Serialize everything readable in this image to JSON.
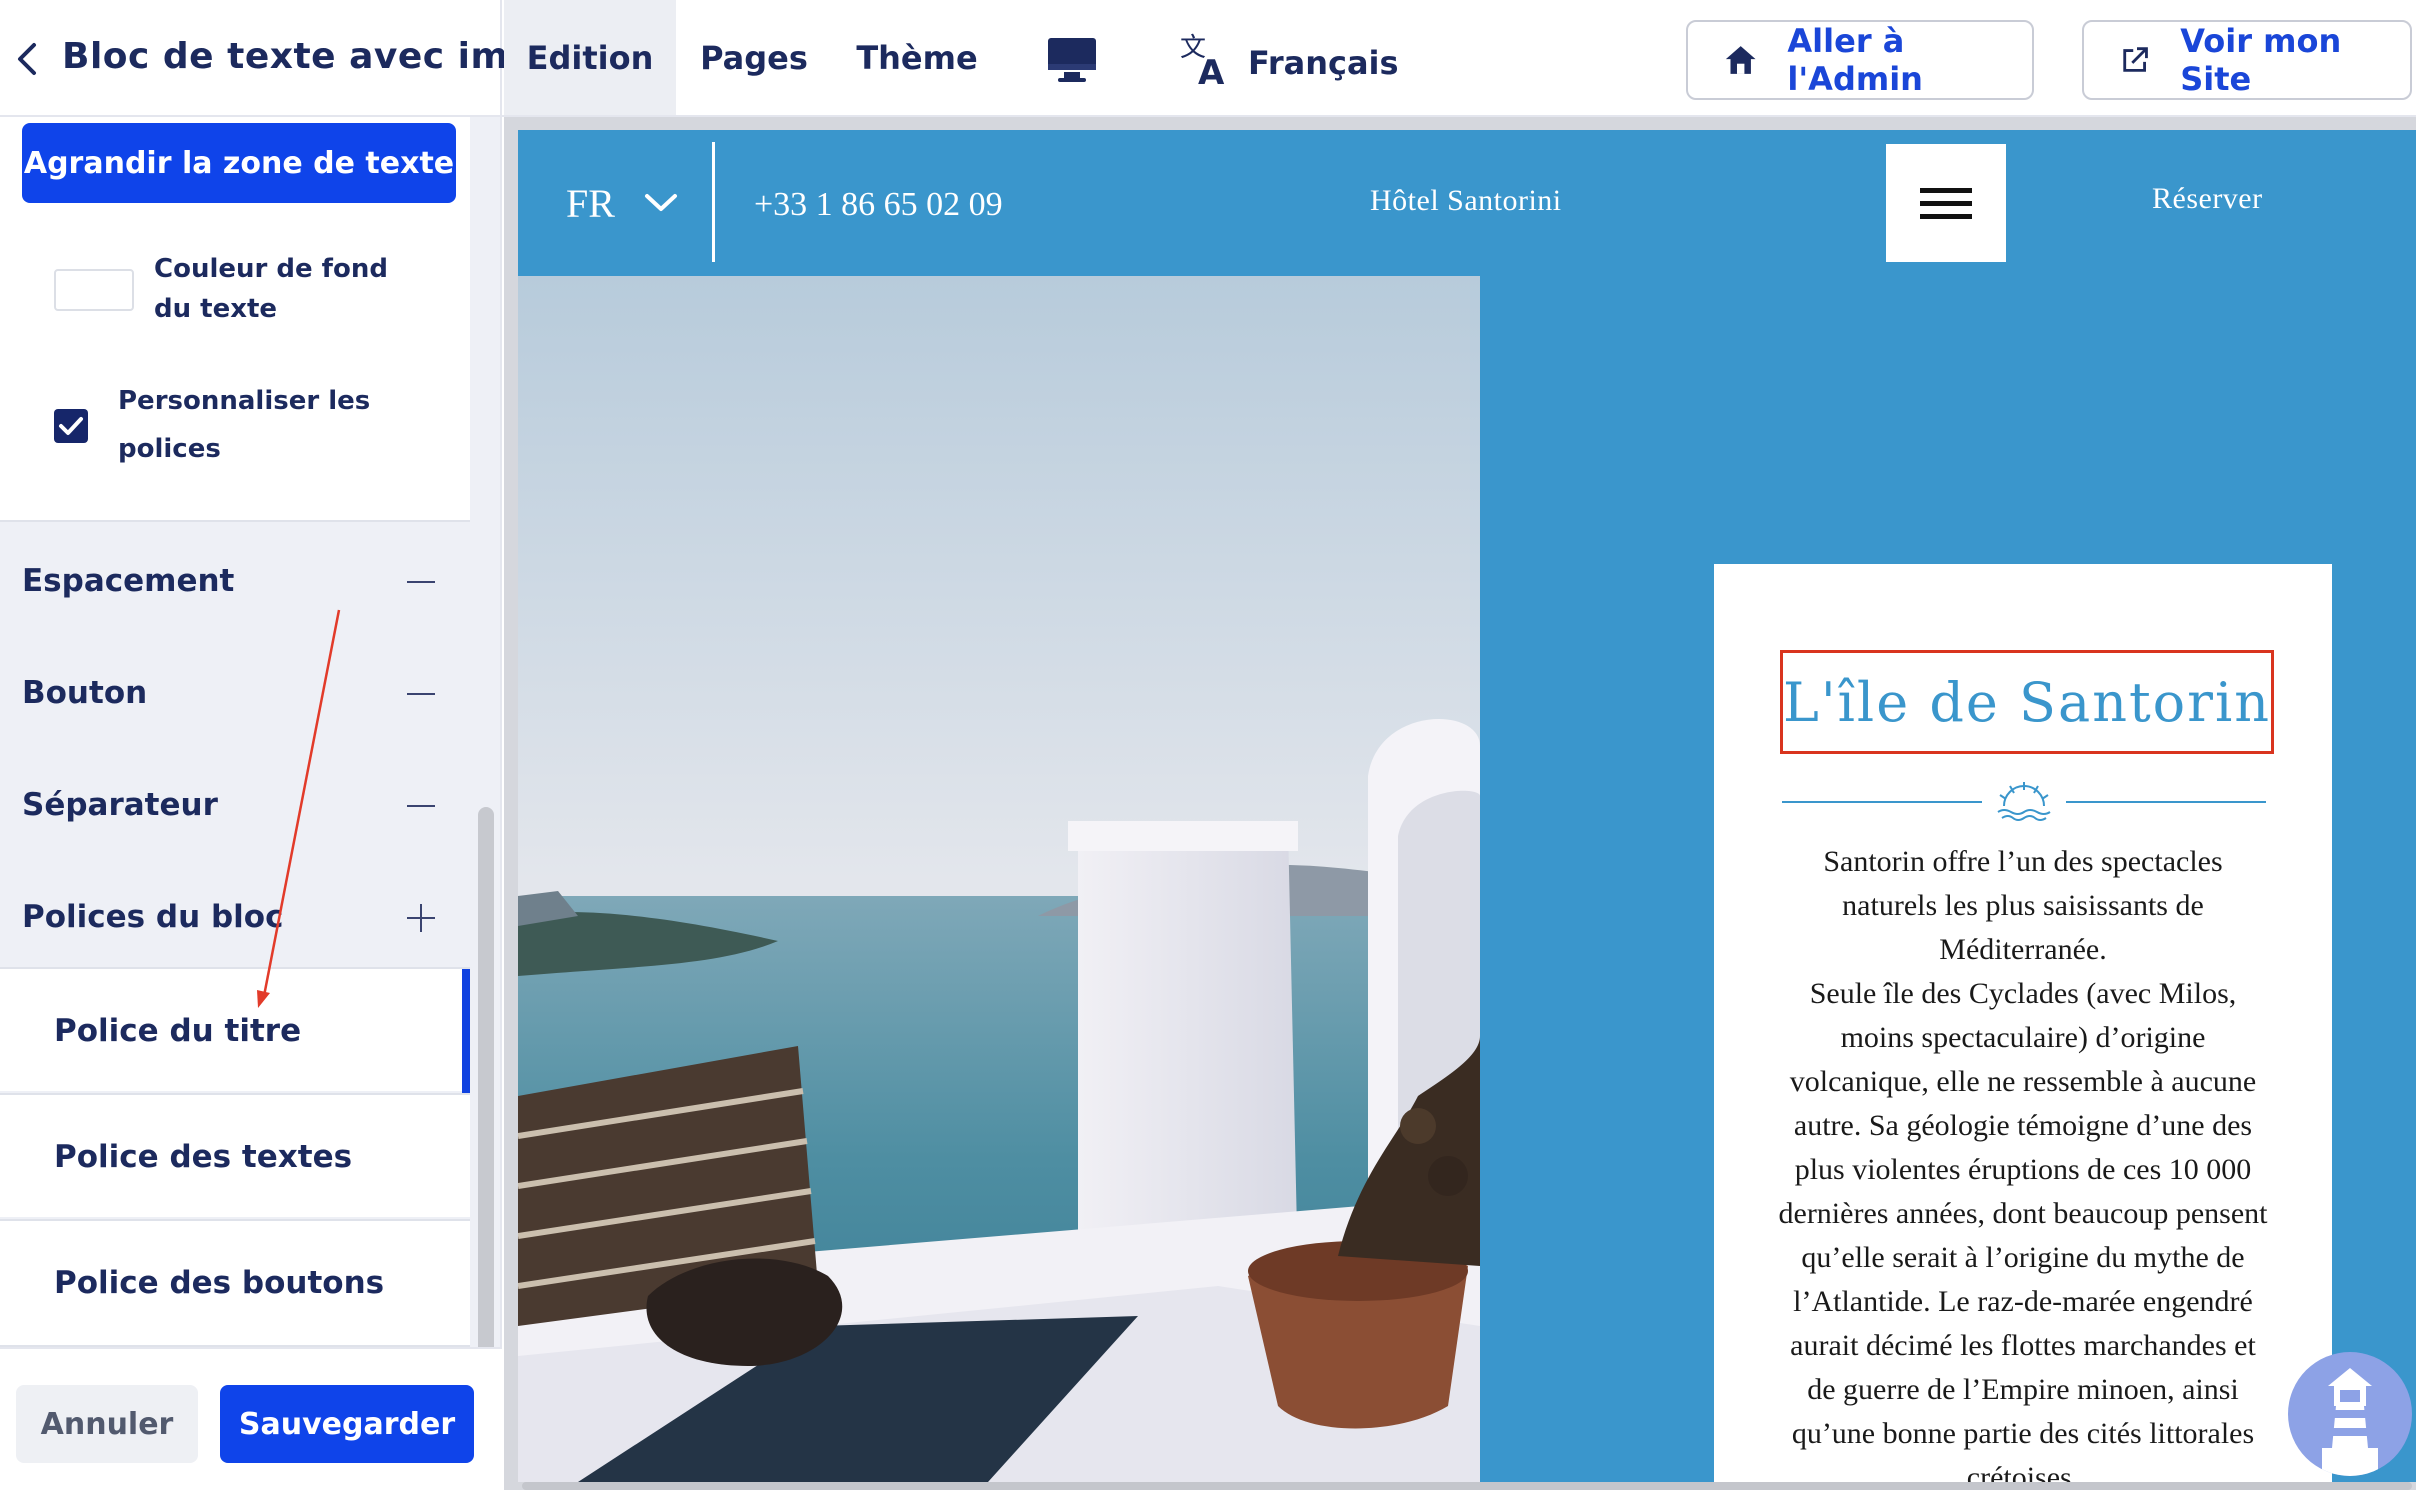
{
  "header": {
    "panel_title": "Bloc de texte avec image",
    "tabs": [
      {
        "label": "Edition",
        "active": true
      },
      {
        "label": "Pages",
        "active": false
      },
      {
        "label": "Thème",
        "active": false
      }
    ],
    "language": "Français",
    "admin_button": "Aller à l'Admin",
    "site_button": "Voir mon Site"
  },
  "panel": {
    "grow_button": "Agrandir la zone de texte",
    "bg_color_label": "Couleur de fond du texte",
    "custom_fonts_label": "Personnaliser les polices",
    "custom_fonts_checked": true,
    "sections": [
      {
        "label": "Espacement",
        "state": "collapse"
      },
      {
        "label": "Bouton",
        "state": "collapse"
      },
      {
        "label": "Séparateur",
        "state": "collapse"
      },
      {
        "label": "Polices du bloc",
        "state": "expand"
      }
    ],
    "subitems": [
      {
        "label": "Police du titre",
        "active": true
      },
      {
        "label": "Police des textes",
        "active": false
      },
      {
        "label": "Police des boutons",
        "active": false
      }
    ],
    "cancel_button": "Annuler",
    "save_button": "Sauvegarder"
  },
  "site": {
    "lang": "FR",
    "phone": "+33 1 86 65 02 09",
    "hotel_name": "Hôtel Santorini",
    "book": "Réserver",
    "card": {
      "title": "L'île de Santorin",
      "paragraphs": [
        "Santorin offre l’un des spectacles naturels les plus saisissants de Méditerranée.",
        "Seule île des Cyclades (avec Milos, moins spectaculaire) d’origine volcanique, elle ne ressemble à aucune autre. Sa géologie témoigne d’une des plus violentes éruptions de ces 10 000 dernières années, dont beaucoup pensent qu’elle serait à l’origine du mythe de l’Atlantide. Le raz-de-marée engendré aurait décimé les flottes marchandes et de guerre de l’Empire minoen, ainsi qu’une bonne partie des cités littorales crétoises."
      ]
    }
  },
  "colors": {
    "primary_blue": "#0f44ea",
    "site_blue": "#3a96cc",
    "navy_text": "#1c2a5e",
    "highlight_red": "#d9341e"
  }
}
